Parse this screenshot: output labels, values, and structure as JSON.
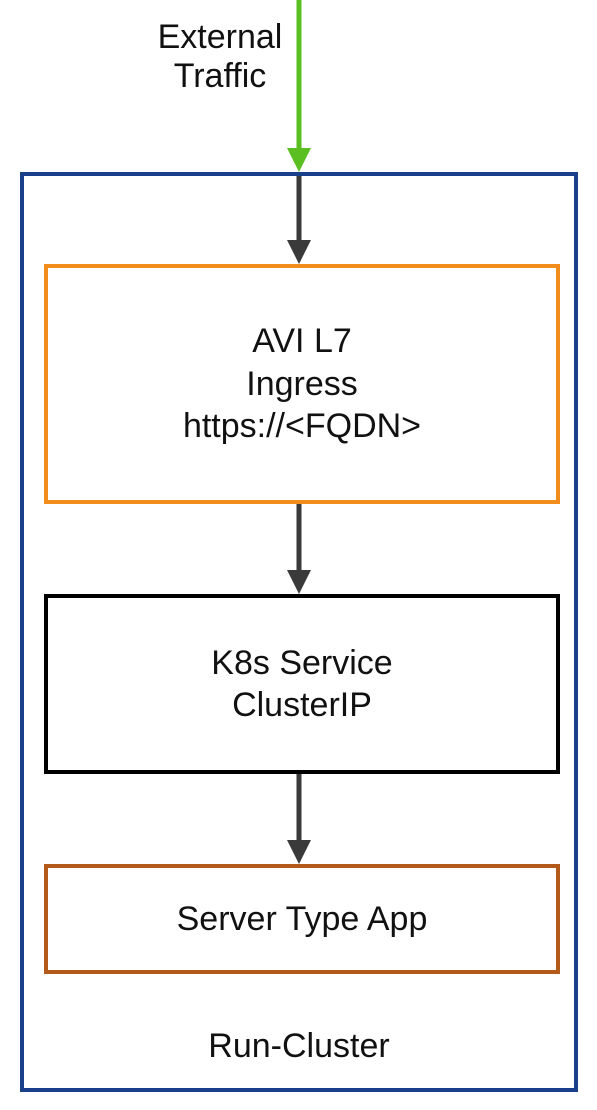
{
  "external_traffic": {
    "line1": "External",
    "line2": "Traffic"
  },
  "cluster": {
    "label": "Run-Cluster",
    "colors": {
      "border": "#1a3f8b",
      "avi_border": "#f28c1a",
      "svc_border": "#000000",
      "app_border": "#b35a1a",
      "external_arrow": "#5bbf21",
      "internal_arrow": "#3a3a3a"
    },
    "nodes": {
      "avi": {
        "line1": "AVI L7",
        "line2": "Ingress",
        "line3": "https://<FQDN>"
      },
      "svc": {
        "line1": "K8s Service",
        "line2": "ClusterIP"
      },
      "app": {
        "line1": "Server Type App"
      }
    }
  }
}
